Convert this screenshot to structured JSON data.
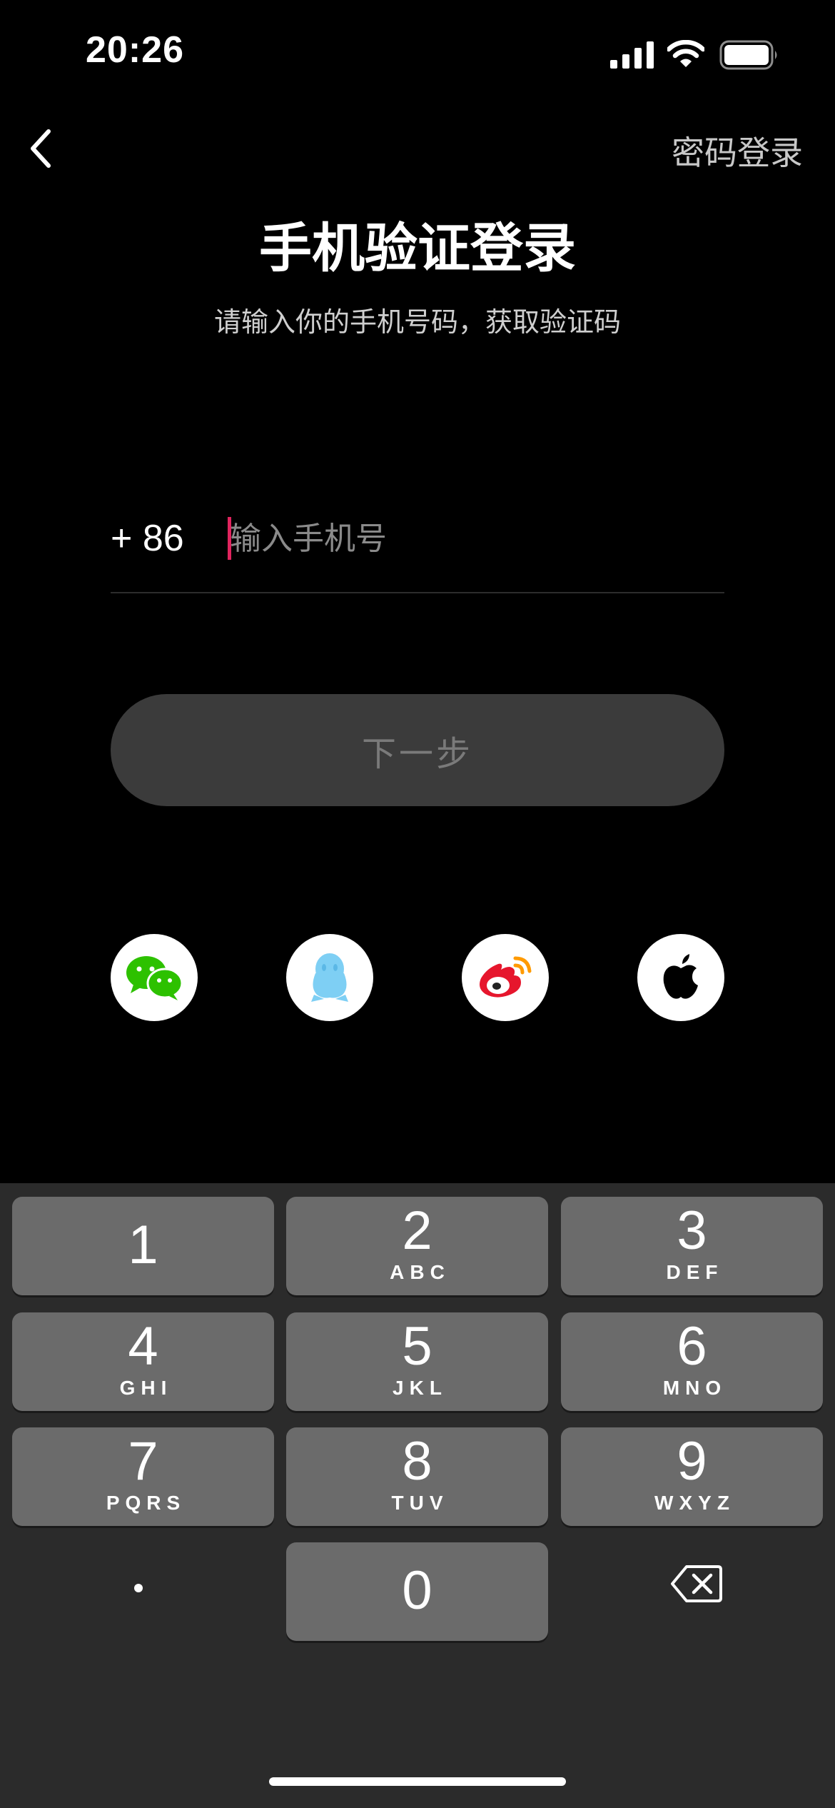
{
  "status_bar": {
    "time": "20:26"
  },
  "nav": {
    "password_login": "密码登录"
  },
  "header": {
    "title": "手机验证登录",
    "subtitle": "请输入你的手机号码，获取验证码"
  },
  "phone": {
    "country_code": "+ 86",
    "placeholder": "输入手机号",
    "value": ""
  },
  "next_button": {
    "label": "下一步"
  },
  "social_logins": [
    "wechat-icon",
    "qq-icon",
    "weibo-icon",
    "apple-icon"
  ],
  "keypad": {
    "keys": [
      {
        "num": "1",
        "letters": ""
      },
      {
        "num": "2",
        "letters": "ABC"
      },
      {
        "num": "3",
        "letters": "DEF"
      },
      {
        "num": "4",
        "letters": "GHI"
      },
      {
        "num": "5",
        "letters": "JKL"
      },
      {
        "num": "6",
        "letters": "MNO"
      },
      {
        "num": "7",
        "letters": "PQRS"
      },
      {
        "num": "8",
        "letters": "TUV"
      },
      {
        "num": "9",
        "letters": "WXYZ"
      },
      {
        "num": "0",
        "letters": ""
      }
    ]
  },
  "colors": {
    "background": "#000000",
    "caret": "#e0245e",
    "button_bg": "#3b3b3b",
    "key_bg": "#6b6b6b",
    "wechat": "#2dc100",
    "qq": "#7ecff4",
    "weibo": "#e6162d"
  }
}
